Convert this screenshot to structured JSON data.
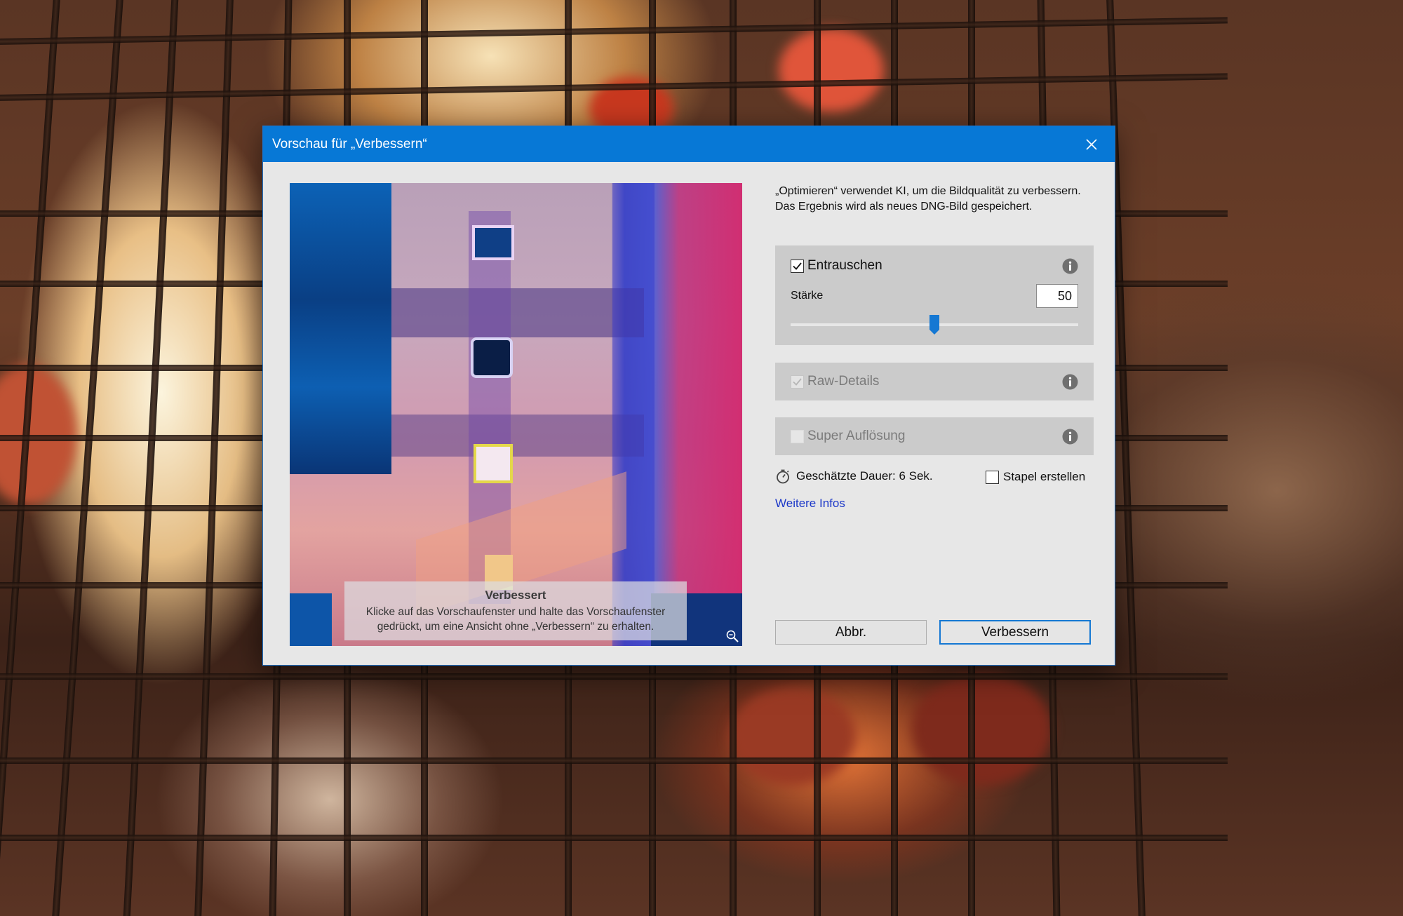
{
  "dialog": {
    "title": "Vorschau für „Verbessern“",
    "description": "„Optimieren“ verwendet KI, um die Bildqualität zu verbessern. Das Ergebnis wird als neues DNG-Bild gespeichert.",
    "preview": {
      "overlay_title": "Verbessert",
      "overlay_text": "Klicke auf das Vorschaufenster und halte das Vorschaufenster gedrückt, um eine Ansicht ohne „Verbessern“ zu erhalten."
    },
    "denoise": {
      "label": "Entrauschen",
      "checked": true,
      "strength_label": "Stärke",
      "strength_value": "50",
      "slider_fraction": 0.5
    },
    "raw_details": {
      "label": "Raw-Details",
      "checked": true,
      "enabled": false
    },
    "super_resolution": {
      "label": "Super Auflösung",
      "checked": false,
      "enabled": false
    },
    "duration_text": "Geschätzte Dauer: 6 Sek.",
    "stack_label": "Stapel erstellen",
    "stack_checked": false,
    "more_info_link": "Weitere Infos",
    "cancel_label": "Abbr.",
    "primary_label": "Verbessern"
  },
  "colors": {
    "titlebar": "#0778d6",
    "accent": "#1578d3",
    "link": "#1b37c8",
    "panel": "#cbcbcb",
    "dialog_bg": "#e7e7e7"
  },
  "icons": [
    "close-icon",
    "info-icon",
    "stopwatch-icon",
    "checkmark-icon",
    "zoom-icon"
  ]
}
